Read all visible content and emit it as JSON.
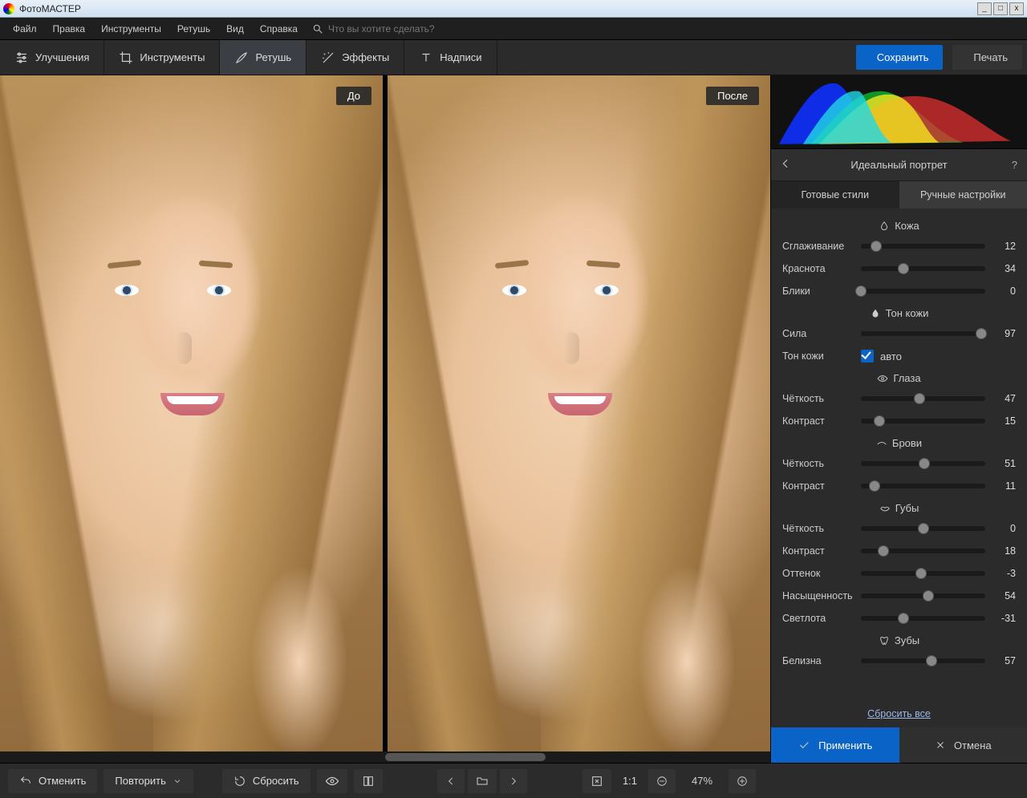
{
  "app": {
    "title": "ФотоМАСТЕР"
  },
  "menu": {
    "items": [
      "Файл",
      "Правка",
      "Инструменты",
      "Ретушь",
      "Вид",
      "Справка"
    ],
    "search_placeholder": "Что вы хотите сделать?"
  },
  "toolbar": {
    "tools": [
      {
        "id": "enhance",
        "label": "Улучшения"
      },
      {
        "id": "tools",
        "label": "Инструменты"
      },
      {
        "id": "retouch",
        "label": "Ретушь",
        "active": true
      },
      {
        "id": "effects",
        "label": "Эффекты"
      },
      {
        "id": "text",
        "label": "Надписи"
      }
    ],
    "save": "Сохранить",
    "print": "Печать"
  },
  "viewer": {
    "before": "До",
    "after": "После"
  },
  "panel": {
    "title": "Идеальный портрет",
    "tabs": {
      "presets": "Готовые стили",
      "manual": "Ручные настройки",
      "active": "manual"
    },
    "groups": {
      "skin": "Кожа",
      "skintone": "Тон кожи",
      "eyes": "Глаза",
      "brows": "Брови",
      "lips": "Губы",
      "teeth": "Зубы"
    },
    "sliders": {
      "smoothing": {
        "label": "Сглаживание",
        "value": 12,
        "min": 0,
        "max": 100
      },
      "redness": {
        "label": "Краснота",
        "value": 34,
        "min": 0,
        "max": 100
      },
      "shine": {
        "label": "Блики",
        "value": 0,
        "min": 0,
        "max": 100
      },
      "strength": {
        "label": "Сила",
        "value": 97,
        "min": 0,
        "max": 100
      },
      "tone_label": {
        "label": "Тон кожи"
      },
      "tone_auto": {
        "label": "авто",
        "checked": true
      },
      "eye_sharp": {
        "label": "Чёткость",
        "value": 47,
        "min": 0,
        "max": 100
      },
      "eye_contr": {
        "label": "Контраст",
        "value": 15,
        "min": 0,
        "max": 100
      },
      "brow_sharp": {
        "label": "Чёткость",
        "value": 51,
        "min": 0,
        "max": 100
      },
      "brow_contr": {
        "label": "Контраст",
        "value": 11,
        "min": 0,
        "max": 100
      },
      "lip_sharp": {
        "label": "Чёткость",
        "value": 0,
        "min": -100,
        "max": 100
      },
      "lip_contr": {
        "label": "Контраст",
        "value": 18,
        "min": 0,
        "max": 100
      },
      "lip_hue": {
        "label": "Оттенок",
        "value": -3,
        "min": -100,
        "max": 100
      },
      "lip_sat": {
        "label": "Насыщенность",
        "value": 54,
        "min": 0,
        "max": 100
      },
      "lip_light": {
        "label": "Светлота",
        "value": -31,
        "min": -100,
        "max": 100
      },
      "whiten": {
        "label": "Белизна",
        "value": 57,
        "min": 0,
        "max": 100
      }
    },
    "reset": "Сбросить все",
    "apply": "Применить",
    "cancel": "Отмена"
  },
  "footer": {
    "undo": "Отменить",
    "redo": "Повторить",
    "reset": "Сбросить",
    "zoom_label": "47%",
    "one_to_one": "1:1"
  }
}
